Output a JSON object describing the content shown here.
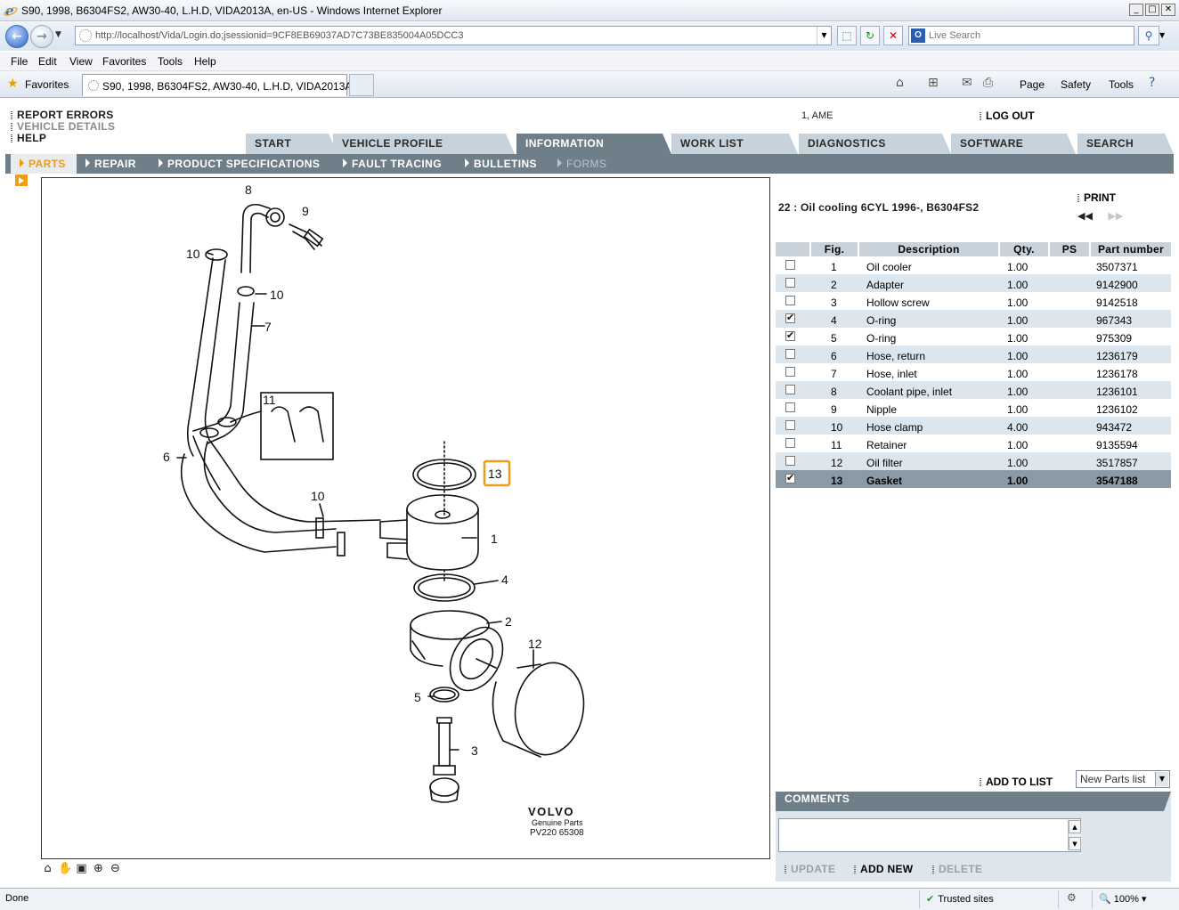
{
  "window": {
    "title": "S90, 1998, B6304FS2, AW30-40, L.H.D, VIDA2013A, en-US - Windows Internet Explorer",
    "min": "_",
    "max": "□",
    "close": "✕"
  },
  "address": {
    "url": "http://localhost/Vida/Login.do;jsessionid=9CF8EB69037AD7C73BE835004A05DCC3",
    "search_placeholder": "Live Search",
    "search_provider_icon": "O"
  },
  "menu": [
    "File",
    "Edit",
    "View",
    "Favorites",
    "Tools",
    "Help"
  ],
  "favbar": {
    "favorites_label": "Favorites",
    "tab_title": "S90, 1998, B6304FS2, AW30-40, L.H.D, VIDA2013A, ...",
    "commands": {
      "page": "Page",
      "safety": "Safety",
      "tools": "Tools"
    }
  },
  "app": {
    "links": {
      "report_errors": "REPORT ERRORS",
      "vehicle_details": "VEHICLE DETAILS",
      "help": "HELP"
    },
    "user": "1, AME",
    "logout": "LOG OUT",
    "tabs": [
      "START",
      "VEHICLE PROFILE",
      "INFORMATION",
      "WORK LIST",
      "DIAGNOSTICS",
      "SOFTWARE",
      "SEARCH"
    ],
    "active_tab": "INFORMATION",
    "subnav": [
      "PARTS",
      "REPAIR",
      "PRODUCT SPECIFICATIONS",
      "FAULT TRACING",
      "BULLETINS",
      "FORMS"
    ],
    "accent_color": "#f29a1a",
    "nav_color": "#6f7f89"
  },
  "diagram": {
    "brand": "VOLVO",
    "brand_sub": "Genuine Parts",
    "ref": "PV220 65308",
    "highlighted_callout": "13",
    "callouts": [
      "8",
      "9",
      "10",
      "10",
      "7",
      "11",
      "6",
      "10",
      "1",
      "4",
      "2",
      "12",
      "5",
      "3",
      "13"
    ]
  },
  "parts": {
    "group_title": "22 : Oil cooling 6CYL 1996-, B6304FS2",
    "print": "PRINT",
    "pager_first": "◀◀",
    "pager_next": "▶▶",
    "columns": [
      "",
      "Fig.",
      "Description",
      "Qty.",
      "PS",
      "Part number"
    ],
    "rows": [
      {
        "checked": false,
        "fig": "1",
        "desc": "Oil cooler",
        "qty": "1.00",
        "ps": "",
        "pn": "3507371",
        "selected": false
      },
      {
        "checked": false,
        "fig": "2",
        "desc": "Adapter",
        "qty": "1.00",
        "ps": "",
        "pn": "9142900",
        "selected": false
      },
      {
        "checked": false,
        "fig": "3",
        "desc": "Hollow screw",
        "qty": "1.00",
        "ps": "",
        "pn": "9142518",
        "selected": false
      },
      {
        "checked": true,
        "fig": "4",
        "desc": "O-ring",
        "qty": "1.00",
        "ps": "",
        "pn": "967343",
        "selected": false
      },
      {
        "checked": true,
        "fig": "5",
        "desc": "O-ring",
        "qty": "1.00",
        "ps": "",
        "pn": "975309",
        "selected": false
      },
      {
        "checked": false,
        "fig": "6",
        "desc": "Hose, return",
        "qty": "1.00",
        "ps": "",
        "pn": "1236179",
        "selected": false
      },
      {
        "checked": false,
        "fig": "7",
        "desc": "Hose, inlet",
        "qty": "1.00",
        "ps": "",
        "pn": "1236178",
        "selected": false
      },
      {
        "checked": false,
        "fig": "8",
        "desc": "Coolant pipe, inlet",
        "qty": "1.00",
        "ps": "",
        "pn": "1236101",
        "selected": false
      },
      {
        "checked": false,
        "fig": "9",
        "desc": "Nipple",
        "qty": "1.00",
        "ps": "",
        "pn": "1236102",
        "selected": false
      },
      {
        "checked": false,
        "fig": "10",
        "desc": "Hose clamp",
        "qty": "4.00",
        "ps": "",
        "pn": "943472",
        "selected": false
      },
      {
        "checked": false,
        "fig": "11",
        "desc": "Retainer",
        "qty": "1.00",
        "ps": "",
        "pn": "9135594",
        "selected": false
      },
      {
        "checked": false,
        "fig": "12",
        "desc": "Oil filter",
        "qty": "1.00",
        "ps": "",
        "pn": "3517857",
        "selected": false
      },
      {
        "checked": true,
        "fig": "13",
        "desc": "Gasket",
        "qty": "1.00",
        "ps": "",
        "pn": "3547188",
        "selected": true
      }
    ],
    "add_to_list": "ADD TO LIST",
    "list_select_value": "New Parts list"
  },
  "comments": {
    "title": "COMMENTS",
    "value": "",
    "update": "UPDATE",
    "add_new": "ADD NEW",
    "delete": "DELETE"
  },
  "status": {
    "text": "Done",
    "zone": "Trusted sites",
    "zoom": "100%"
  }
}
